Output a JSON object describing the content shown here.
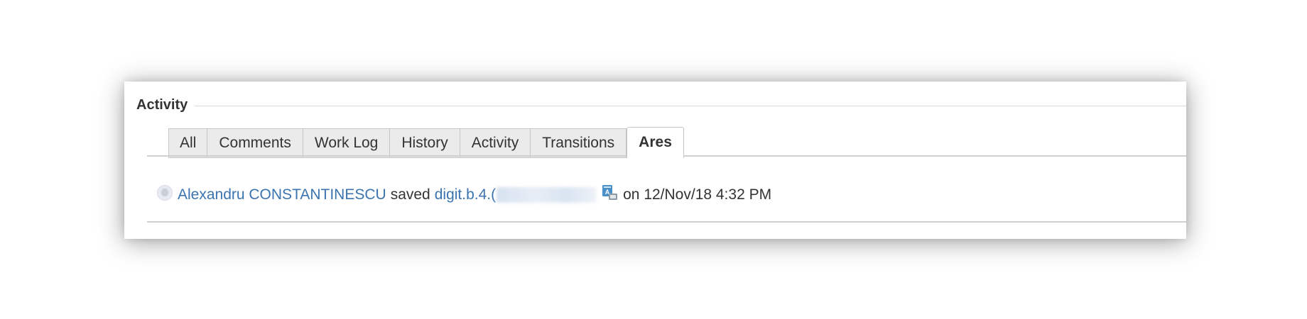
{
  "panel": {
    "title": "Activity"
  },
  "tabs": [
    {
      "label": "All"
    },
    {
      "label": "Comments"
    },
    {
      "label": "Work Log"
    },
    {
      "label": "History"
    },
    {
      "label": "Activity"
    },
    {
      "label": "Transitions"
    },
    {
      "label": "Ares",
      "active": true
    }
  ],
  "entry": {
    "user": "Alexandru CONSTANTINESCU",
    "action": "saved",
    "item": "digit.b.4.(",
    "date_text": "on 12/Nov/18 4:32 PM",
    "icons": [
      "avatar-icon",
      "attachment-icon"
    ]
  },
  "colors": {
    "link": "#3b73af",
    "text": "#333333",
    "tab_bg": "#ebebeb",
    "rule": "#cfcfcf"
  }
}
